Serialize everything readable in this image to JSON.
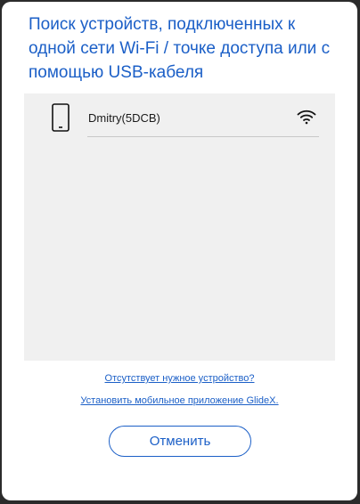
{
  "dialog": {
    "title": "Поиск устройств, подключенных к одной сети Wi-Fi / точке доступа или с помощью USB-кабеля"
  },
  "devices": [
    {
      "name": "Dmitry(5DCB)",
      "icon": "phone-icon",
      "connection_icon": "wifi-icon"
    }
  ],
  "links": {
    "missing_device": "Отсутствует нужное устройство?",
    "install_app": "Установить мобильное приложение GlideX."
  },
  "buttons": {
    "cancel": "Отменить"
  },
  "colors": {
    "accent": "#1b5fc7",
    "panel_bg": "#f0f0f0"
  }
}
